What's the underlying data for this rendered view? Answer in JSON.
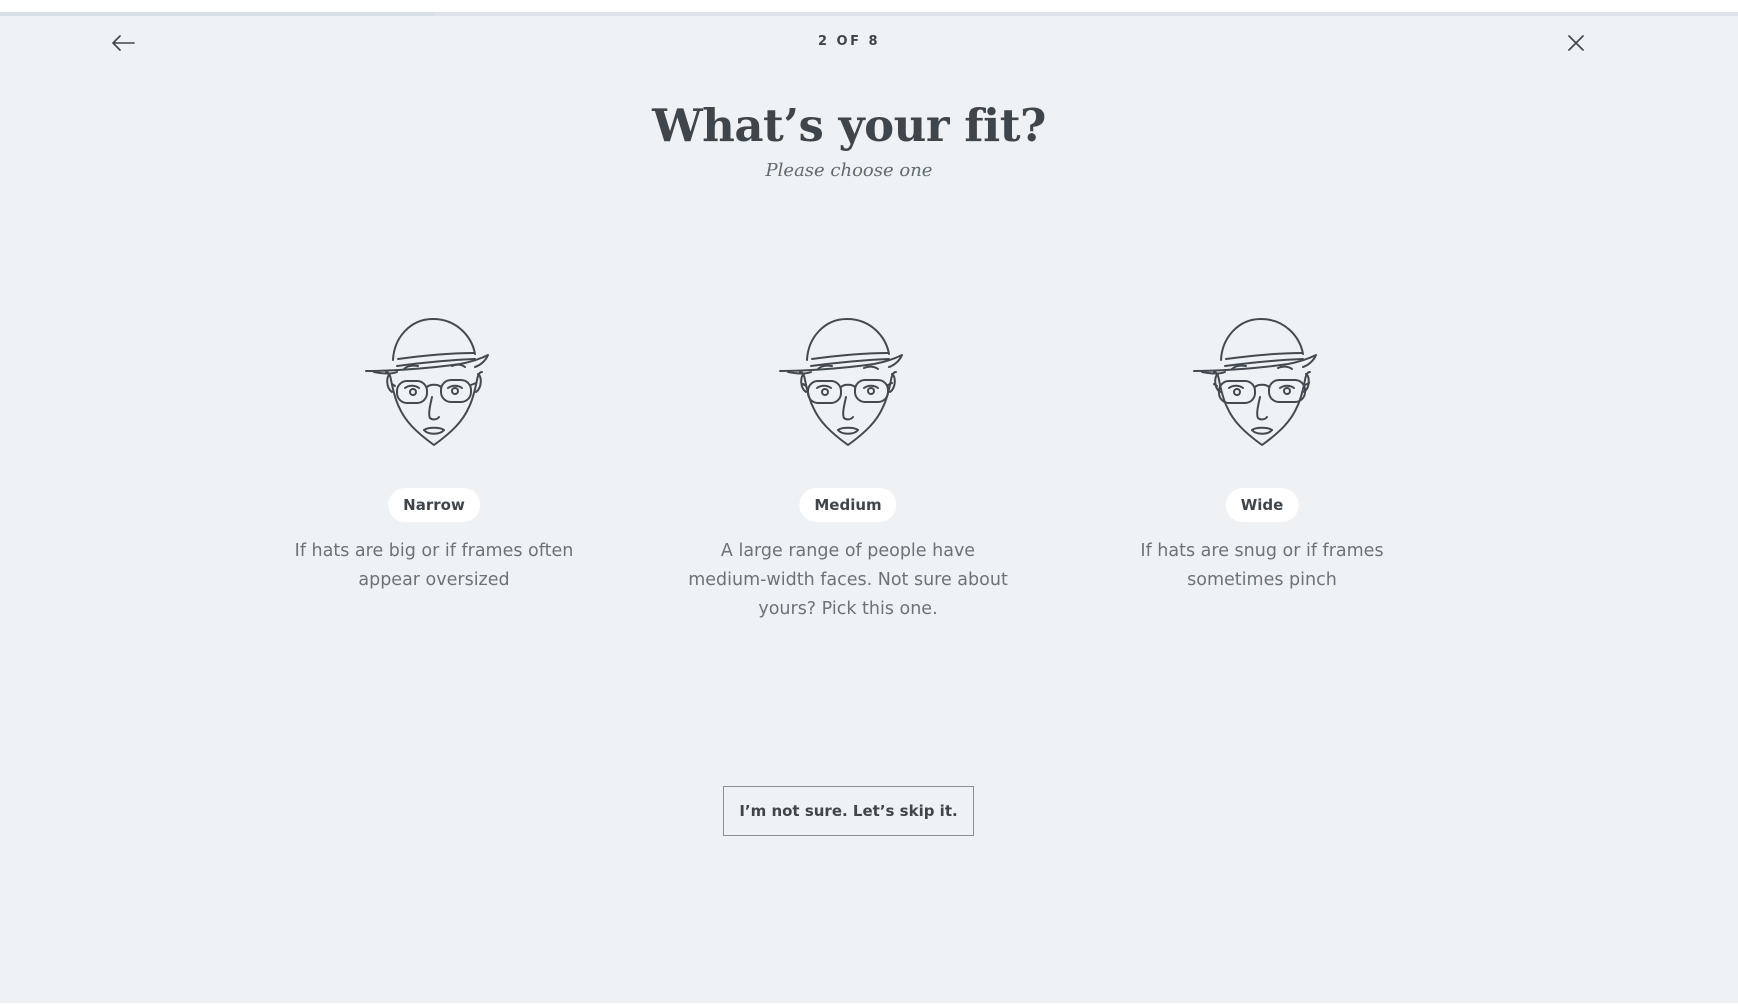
{
  "quiz": {
    "step_label": "2 OF 8",
    "progress_fraction": 0.25
  },
  "header": {
    "title": "What’s your fit?",
    "subtitle": "Please choose one"
  },
  "options": [
    {
      "label": "Narrow",
      "description": "If hats are big or if frames often appear oversized",
      "icon": "narrow-face-icon"
    },
    {
      "label": "Medium",
      "description": "A large range of people have medium-width faces. Not sure about yours? Pick this one.",
      "icon": "medium-face-icon"
    },
    {
      "label": "Wide",
      "description": "If hats are snug or if frames sometimes pinch",
      "icon": "wide-face-icon"
    }
  ],
  "skip": {
    "label": "I’m not sure. Let’s skip it."
  },
  "colors": {
    "background": "#eef2f5",
    "text": "#3f464b",
    "muted_text": "#6b7379",
    "pill": "#ffffff"
  }
}
